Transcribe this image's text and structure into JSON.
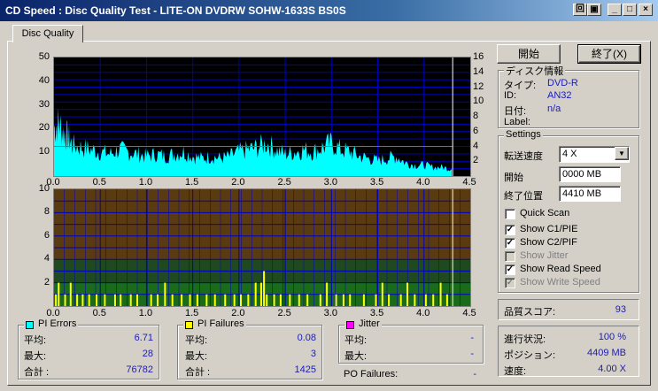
{
  "window": {
    "title": "CD Speed : Disc Quality Test - LITE-ON DVDRW SOHW-1633S BS0S",
    "buttons": [
      "回",
      "▣",
      "_",
      "□",
      "×"
    ]
  },
  "tab": {
    "label": "Disc Quality"
  },
  "top_chart": {
    "y_left_ticks": [
      "50",
      "40",
      "30",
      "20",
      "10"
    ],
    "y_right_ticks": [
      "16",
      "14",
      "12",
      "10",
      "8",
      "6",
      "4",
      "2"
    ],
    "x_ticks": [
      "0.0",
      "0.5",
      "1.0",
      "1.5",
      "2.0",
      "2.5",
      "3.0",
      "3.5",
      "4.0",
      "4.5"
    ]
  },
  "bottom_chart": {
    "y_ticks": [
      "10",
      "8",
      "6",
      "4",
      "2"
    ],
    "x_ticks": [
      "0.0",
      "0.5",
      "1.0",
      "1.5",
      "2.0",
      "2.5",
      "3.0",
      "3.5",
      "4.0",
      "4.5"
    ]
  },
  "chart_data": [
    {
      "type": "area",
      "x_range": [
        0,
        4.5
      ],
      "ylim": [
        0,
        50
      ],
      "ylim_right": [
        0,
        16
      ],
      "x_end_position": 4.31,
      "pi_errors_profile": [
        [
          0.0,
          22
        ],
        [
          0.05,
          24
        ],
        [
          0.1,
          20
        ],
        [
          0.15,
          18
        ],
        [
          0.2,
          14
        ],
        [
          0.3,
          13
        ],
        [
          0.4,
          12
        ],
        [
          0.5,
          11
        ],
        [
          0.6,
          10
        ],
        [
          0.7,
          12
        ],
        [
          0.8,
          11
        ],
        [
          0.9,
          10
        ],
        [
          1.0,
          9
        ],
        [
          1.1,
          10
        ],
        [
          1.2,
          9
        ],
        [
          1.3,
          10
        ],
        [
          1.4,
          11
        ],
        [
          1.5,
          9
        ],
        [
          1.6,
          8
        ],
        [
          1.7,
          9
        ],
        [
          1.8,
          8
        ],
        [
          1.9,
          9
        ],
        [
          2.0,
          11
        ],
        [
          2.1,
          12
        ],
        [
          2.2,
          13
        ],
        [
          2.3,
          15
        ],
        [
          2.4,
          12
        ],
        [
          2.5,
          10
        ],
        [
          2.6,
          11
        ],
        [
          2.7,
          12
        ],
        [
          2.8,
          11
        ],
        [
          2.9,
          13
        ],
        [
          3.0,
          15
        ],
        [
          3.1,
          12
        ],
        [
          3.2,
          11
        ],
        [
          3.3,
          9
        ],
        [
          3.4,
          8
        ],
        [
          3.5,
          7
        ],
        [
          3.6,
          8
        ],
        [
          3.7,
          9
        ],
        [
          3.8,
          6
        ],
        [
          3.9,
          5
        ],
        [
          4.0,
          5
        ],
        [
          4.1,
          4
        ],
        [
          4.2,
          4
        ],
        [
          4.3,
          3
        ]
      ],
      "read_speed_right_axis": 4.0,
      "colors": {
        "errors": "#00ffff",
        "speed": "#00c000",
        "grid": "#0000c0",
        "background": "#000000",
        "end_marker": "#ffffff"
      }
    },
    {
      "type": "bar",
      "x_range": [
        0,
        4.5
      ],
      "ylim": [
        0,
        10
      ],
      "x_end_position": 4.31,
      "pi_failure_spikes": [
        [
          0.02,
          1
        ],
        [
          0.05,
          2
        ],
        [
          0.12,
          1
        ],
        [
          0.18,
          2
        ],
        [
          0.25,
          1
        ],
        [
          0.31,
          1
        ],
        [
          0.38,
          1
        ],
        [
          0.46,
          1
        ],
        [
          0.55,
          1
        ],
        [
          0.66,
          1
        ],
        [
          0.72,
          1
        ],
        [
          0.83,
          1
        ],
        [
          0.9,
          1
        ],
        [
          1.05,
          1
        ],
        [
          1.12,
          1
        ],
        [
          1.2,
          2
        ],
        [
          1.28,
          1
        ],
        [
          1.38,
          1
        ],
        [
          1.47,
          1
        ],
        [
          1.55,
          1
        ],
        [
          1.65,
          1
        ],
        [
          1.74,
          1
        ],
        [
          1.85,
          1
        ],
        [
          1.95,
          1
        ],
        [
          2.02,
          1
        ],
        [
          2.1,
          1
        ],
        [
          2.18,
          2
        ],
        [
          2.24,
          2
        ],
        [
          2.27,
          3
        ],
        [
          2.3,
          1
        ],
        [
          2.38,
          1
        ],
        [
          2.45,
          1
        ],
        [
          2.55,
          1
        ],
        [
          2.65,
          1
        ],
        [
          2.74,
          1
        ],
        [
          2.88,
          1
        ],
        [
          2.95,
          2
        ],
        [
          3.05,
          1
        ],
        [
          3.13,
          1
        ],
        [
          3.2,
          1
        ],
        [
          3.35,
          1
        ],
        [
          3.48,
          1
        ],
        [
          3.55,
          2
        ],
        [
          3.62,
          1
        ],
        [
          3.75,
          1
        ],
        [
          3.82,
          2
        ],
        [
          3.9,
          1
        ],
        [
          4.02,
          1
        ],
        [
          4.1,
          1
        ],
        [
          4.18,
          2
        ],
        [
          4.25,
          1
        ]
      ],
      "colors": {
        "failures": "#ffff00",
        "upper_band": "#5a3a10",
        "lower_band": "#1f4a1f",
        "bottom_band": "#1a6b1a",
        "grid": "#0000c0"
      }
    }
  ],
  "controls": {
    "start_button": "開始",
    "stop_button": "終了(X)"
  },
  "disc_info": {
    "title": "ディスク情報",
    "type_label": "タイプ:",
    "type_value": "DVD-R",
    "id_label": "ID:",
    "id_value": "AN32",
    "date_label": "日付:",
    "date_value": "n/a",
    "label_label": "Label:",
    "label_value": ""
  },
  "settings": {
    "title": "Settings",
    "speed_label": "転送速度",
    "speed_value": "4 X",
    "start_label": "開始",
    "start_value": "0000 MB",
    "end_label": "終了位置",
    "end_value": "4410 MB",
    "checkboxes": [
      {
        "label": "Quick Scan",
        "checked": false,
        "enabled": true,
        "mark": ""
      },
      {
        "label": "Show C1/PIE",
        "checked": true,
        "enabled": true,
        "mark": "✓"
      },
      {
        "label": "Show C2/PIF",
        "checked": true,
        "enabled": true,
        "mark": "✓"
      },
      {
        "label": "Show Jitter",
        "checked": false,
        "enabled": false,
        "mark": ""
      },
      {
        "label": "Show Read Speed",
        "checked": true,
        "enabled": true,
        "mark": "✓"
      },
      {
        "label": "Show Write Speed",
        "checked": true,
        "enabled": false,
        "mark": "✓"
      }
    ]
  },
  "quality": {
    "label": "品質スコア:",
    "value": "93"
  },
  "progress": {
    "progress_label": "進行状況:",
    "progress_value": "100 %",
    "position_label": "ポジション:",
    "position_value": "4409 MB",
    "speed_label": "速度:",
    "speed_value": "4.00 X"
  },
  "pi_errors": {
    "title": "PI Errors",
    "color": "#00ffff",
    "avg_label": "平均:",
    "avg": "6.71",
    "max_label": "最大:",
    "max": "28",
    "total_label": "合計 :",
    "total": "76782"
  },
  "pi_failures": {
    "title": "PI Failures",
    "color": "#ffff00",
    "avg_label": "平均:",
    "avg": "0.08",
    "max_label": "最大:",
    "max": "3",
    "total_label": "合計 :",
    "total": "1425"
  },
  "jitter": {
    "title": "Jitter",
    "color": "#ff00ff",
    "avg_label": "平均:",
    "avg": "-",
    "max_label": "最大:",
    "max": "-"
  },
  "po_failures": {
    "label": "PO Failures:",
    "value": "-"
  }
}
